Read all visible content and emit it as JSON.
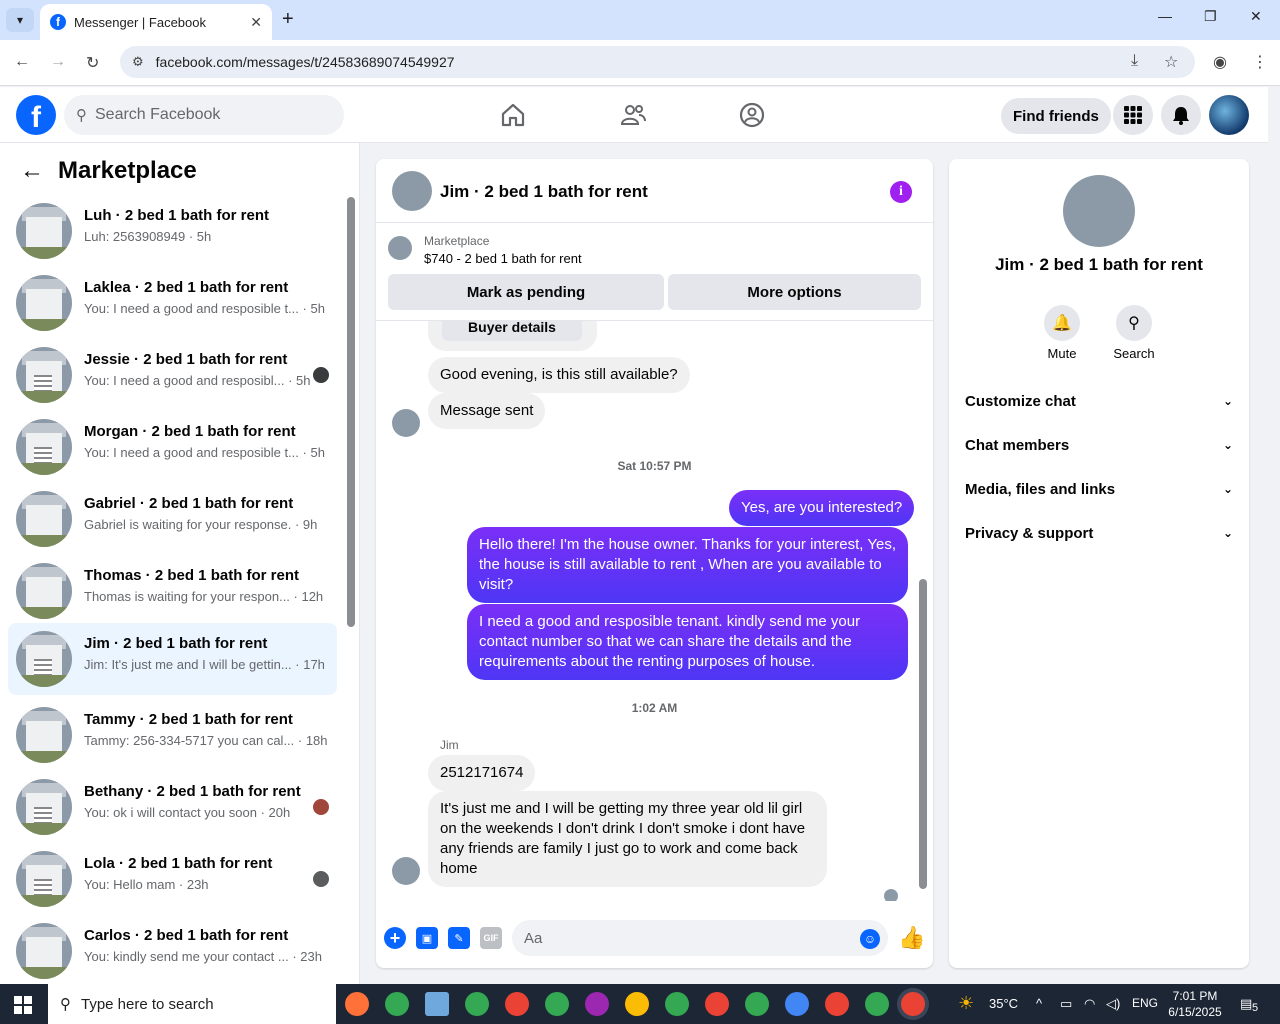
{
  "browser": {
    "tab_title": "Messenger | Facebook",
    "url": "facebook.com/messages/t/24583689074549927"
  },
  "fb": {
    "search_placeholder": "Search Facebook",
    "find_friends": "Find friends"
  },
  "sidebar": {
    "title": "Marketplace",
    "conversations": [
      {
        "name": "Luh · 2 bed 1 bath for rent",
        "snippet": "Luh: 2563908949 · 5h"
      },
      {
        "name": "Laklea · 2 bed 1 bath for rent",
        "snippet": "You: I need a good and resposible t... · 5h"
      },
      {
        "name": "Jessie · 2 bed 1 bath for rent",
        "snippet": "You: I need a good and resposibl... · 5h"
      },
      {
        "name": "Morgan · 2 bed 1 bath for rent",
        "snippet": "You: I need a good and resposible t... · 5h"
      },
      {
        "name": "Gabriel · 2 bed 1 bath for rent",
        "snippet": "Gabriel is waiting for your response. · 9h"
      },
      {
        "name": "Thomas · 2 bed 1 bath for rent",
        "snippet": "Thomas is waiting for your respon... · 12h"
      },
      {
        "name": "Jim · 2 bed 1 bath for rent",
        "snippet": "Jim: It's just me and I will be gettin... · 17h"
      },
      {
        "name": "Tammy · 2 bed 1 bath for rent",
        "snippet": "Tammy: 256-334-5717 you can cal... · 18h"
      },
      {
        "name": "Bethany · 2 bed 1 bath for rent",
        "snippet": "You: ok i will contact you soon · 20h"
      },
      {
        "name": "Lola · 2 bed 1 bath for rent",
        "snippet": "You: Hello mam · 23h"
      },
      {
        "name": "Carlos · 2 bed 1 bath for rent",
        "snippet": "You: kindly send me your contact ... · 23h"
      }
    ]
  },
  "chat": {
    "title": "Jim · 2 bed 1 bath for rent",
    "listing_source": "Marketplace",
    "listing_price": "$740 - 2 bed 1 bath for rent",
    "mark_pending": "Mark as pending",
    "more_options": "More options",
    "buyer_details": "Buyer details",
    "msg_good_evening": "Good evening, is this still available?",
    "msg_sent": "Message sent",
    "ts1": "Sat 10:57 PM",
    "out1": "Yes, are you interested?",
    "out2": "Hello there! I'm the house owner. Thanks for your interest, Yes, the house is still available to rent , When are you available to visit?",
    "out3": "I need a good and resposible tenant.  kindly send me your contact number so that we can share the details and the requirements about the renting purposes of house.",
    "ts2": "1:02 AM",
    "sender": "Jim",
    "in_phone": "2512171674",
    "in_long": "It's just me and I will be getting my three year old lil girl on the weekends I don't drink I don't smoke i dont have any friends are family I just go to work and come back home",
    "composer_placeholder": "Aa",
    "gif_label": "GIF"
  },
  "details": {
    "name": "Jim · 2 bed 1 bath for rent",
    "mute": "Mute",
    "search": "Search",
    "rows": [
      "Customize chat",
      "Chat members",
      "Media, files and links",
      "Privacy & support"
    ]
  },
  "taskbar": {
    "search_placeholder": "Type here to search",
    "temperature": "35°C",
    "lang": "ENG",
    "time": "7:01 PM",
    "date": "6/15/2025",
    "notifications": "5"
  }
}
